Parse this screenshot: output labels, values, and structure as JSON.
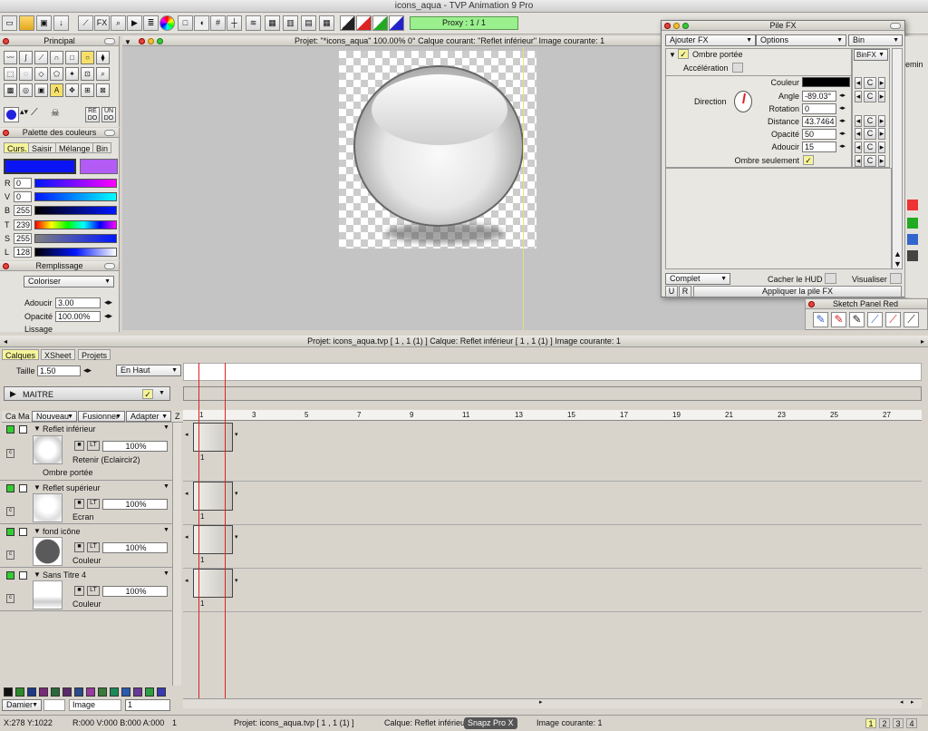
{
  "window": {
    "title": "icons_aqua - TVP Animation 9 Pro"
  },
  "toolbar": {
    "fx": "FX",
    "proxy": "Proxy : 1 / 1"
  },
  "principal": {
    "title": "Principal",
    "redo": "RE\nDO",
    "undo": "UN\nDO"
  },
  "palette": {
    "title": "Palette des couleurs",
    "tabs": [
      "Curs.",
      "Saisir",
      "Mélange",
      "Bin"
    ],
    "rows": [
      {
        "label": "R",
        "value": "0"
      },
      {
        "label": "V",
        "value": "0"
      },
      {
        "label": "B",
        "value": "255"
      },
      {
        "label": "T",
        "value": "239"
      },
      {
        "label": "S",
        "value": "255"
      },
      {
        "label": "L",
        "value": "128"
      }
    ],
    "main_color": "#0a14f5",
    "secondary_color": "#b25cf5"
  },
  "fill": {
    "title": "Remplissage",
    "mode": "Coloriser",
    "adoucir_label": "Adoucir",
    "adoucir": "3.00",
    "opacite_label": "Opacité",
    "opacite": "100.00%",
    "lissage": "Lissage"
  },
  "canvas": {
    "info": "Projet:  \"*icons_aqua\"   100.00%   0°   Calque courant: \"Reflet inférieur\"   Image courante: 1"
  },
  "pilefx": {
    "title": "Pile FX",
    "add": "Ajouter FX",
    "options": "Options",
    "bin": "Bin",
    "effect": "Ombre portée",
    "binfx": "BinFX",
    "accel": "Accélération",
    "direction": "Direction",
    "params": [
      {
        "label": "Couleur",
        "value": ""
      },
      {
        "label": "Angle",
        "value": "-89.03°"
      },
      {
        "label": "Rotation",
        "value": "0"
      },
      {
        "label": "Distance",
        "value": "43.7464"
      },
      {
        "label": "Opacité",
        "value": "50"
      },
      {
        "label": "Adoucir",
        "value": "15"
      }
    ],
    "only_shadow": "Ombre seulement",
    "c": "C",
    "mode": "Complet",
    "hud": "Cacher le HUD",
    "visualize": "Visualiser",
    "u": "U",
    "r": "R",
    "apply": "Appliquer la pile FX"
  },
  "sketch": {
    "title": "Sketch Panel Red",
    "chemin": "emin"
  },
  "timeline": {
    "info": "Projet: icons_aqua.tvp [ 1 , 1  (1) ]          Calque: Reflet inférieur [ 1 , 1  (1) ]          Image courante: 1",
    "tabs": [
      "Calques",
      "XSheet",
      "Projets"
    ],
    "taille_label": "Taille",
    "taille": "1.50",
    "position": "En Haut",
    "maitre": "MAITRE",
    "headers": [
      "Ca",
      "Ma",
      "Nouveau",
      "Fusionner",
      "Adapter",
      "Z"
    ],
    "ticks": [
      "1",
      "3",
      "5",
      "7",
      "9",
      "11",
      "13",
      "15",
      "17",
      "19",
      "21",
      "23",
      "25",
      "27"
    ],
    "layers": [
      {
        "name": "Reflet inférieur",
        "opacity": "100%",
        "mode": "Retenir (Eclaircir2)",
        "fx": "Ombre portée",
        "frame": "1"
      },
      {
        "name": "Reflet supérieur",
        "opacity": "100%",
        "mode": "Ecran",
        "fx": "",
        "frame": "1"
      },
      {
        "name": "fond icône",
        "opacity": "100%",
        "mode": "Couleur",
        "fx": "",
        "frame": "1"
      },
      {
        "name": "Sans Titre 4",
        "opacity": "100%",
        "mode": "Couleur",
        "fx": "",
        "frame": "1"
      }
    ],
    "lock": "LT",
    "bottom_mode": "Damier",
    "image_label": "Image",
    "image_value": "1"
  },
  "status": {
    "coords": "X:278   Y:1022",
    "rgba": "R:000 V:000 B:000 A:000",
    "num": "1",
    "projet": "Projet: icons_aqua.tvp [ 1 , 1  (1) ]",
    "calque": "Calque: Reflet inférieur",
    "snapz": "Snapz Pro X",
    "image": "Image courante: 1",
    "pages": [
      "1",
      "2",
      "3",
      "4"
    ]
  }
}
